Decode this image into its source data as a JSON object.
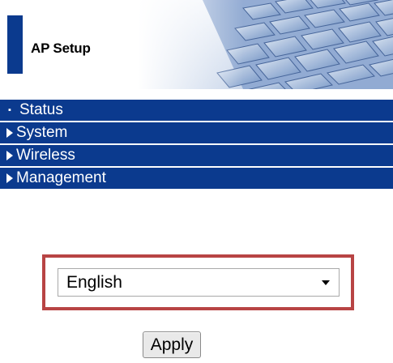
{
  "header": {
    "title": "AP Setup"
  },
  "menu": {
    "items": [
      {
        "label": "Status",
        "icon": "bullet-icon"
      },
      {
        "label": "System",
        "icon": "arrow-right-icon"
      },
      {
        "label": "Wireless",
        "icon": "arrow-right-icon"
      },
      {
        "label": "Management",
        "icon": "arrow-right-icon"
      }
    ]
  },
  "language": {
    "selected": "English"
  },
  "actions": {
    "apply_label": "Apply"
  },
  "colors": {
    "menu_background": "#0b3a8e",
    "highlight_border": "#b84444"
  }
}
